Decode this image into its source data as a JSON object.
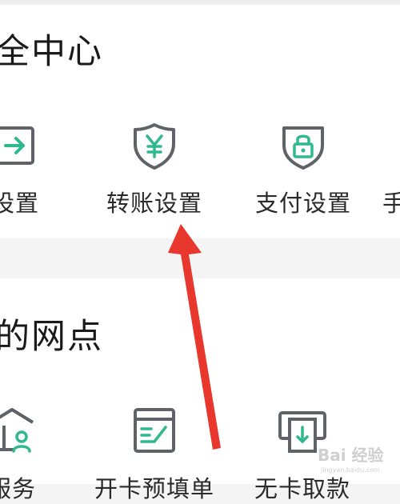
{
  "security_center": {
    "title": "全中心",
    "items": [
      {
        "label": "设置",
        "icon": "transfer-arrow-icon"
      },
      {
        "label": "转账设置",
        "icon": "shield-yen-icon"
      },
      {
        "label": "支付设置",
        "icon": "shield-lock-icon"
      },
      {
        "label": "手",
        "icon": "partial-icon"
      }
    ]
  },
  "outlets": {
    "title": "的网点",
    "items": [
      {
        "label": "服务",
        "icon": "bank-person-icon"
      },
      {
        "label": "开卡预填单",
        "icon": "form-pen-icon"
      },
      {
        "label": "无卡取款",
        "icon": "cash-withdraw-icon"
      }
    ]
  },
  "colors": {
    "accent": "#2fb98c",
    "icon_stroke": "#5f6368",
    "arrow": "#e8372c",
    "background": "#f4f4f5",
    "card": "#ffffff"
  },
  "watermark": {
    "text": "Bai 经验",
    "subtext": "jingyan.baidu.com"
  }
}
